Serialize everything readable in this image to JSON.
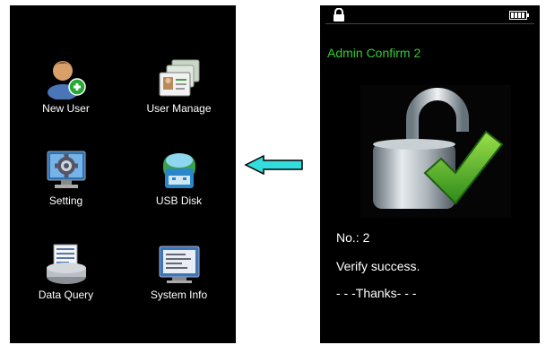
{
  "left_menu": {
    "items": [
      {
        "label": "New User",
        "icon": "new-user-icon"
      },
      {
        "label": "User  Manage",
        "icon": "user-manage-icon"
      },
      {
        "label": "Setting",
        "icon": "setting-icon"
      },
      {
        "label": "USB  Disk",
        "icon": "usb-disk-icon"
      },
      {
        "label": "Data  Query",
        "icon": "data-query-icon"
      },
      {
        "label": "System Info",
        "icon": "system-info-icon"
      }
    ]
  },
  "arrow": {
    "direction": "left",
    "color": "#33dddd"
  },
  "right_screen": {
    "status_icons": [
      "lock-icon",
      "battery-icon"
    ],
    "title": "Admin Confirm 2",
    "title_color": "#33cc33",
    "lock_graphic": "unlocked-padlock-checkmark",
    "number_line": "No.: 2",
    "result_line": "Verify success.",
    "thanks_line": "- - -Thanks- - -"
  }
}
